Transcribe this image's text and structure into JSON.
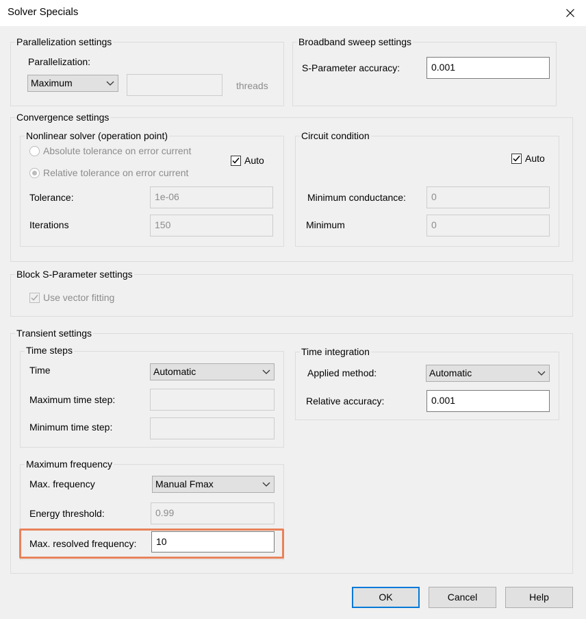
{
  "window": {
    "title": "Solver Specials"
  },
  "parallelization": {
    "group_title": "Parallelization settings",
    "label": "Parallelization:",
    "selected": "Maximum",
    "threads_value": "",
    "threads_label": "threads"
  },
  "broadband": {
    "group_title": "Broadband sweep settings",
    "accuracy_label": "S-Parameter accuracy:",
    "accuracy_value": "0.001"
  },
  "convergence": {
    "group_title": "Convergence settings",
    "nonlinear": {
      "group_title": "Nonlinear solver (operation point)",
      "radio_absolute": "Absolute tolerance on error current",
      "radio_relative": "Relative tolerance on error current",
      "auto_label": "Auto",
      "tolerance_label": "Tolerance:",
      "tolerance_value": "1e-06",
      "iterations_label": "Iterations",
      "iterations_value": "150"
    },
    "circuit": {
      "group_title": "Circuit condition",
      "auto_label": "Auto",
      "min_conductance_label": "Minimum conductance:",
      "min_conductance_value": "0",
      "minimum_label": "Minimum",
      "minimum_value": "0"
    }
  },
  "block_sparam": {
    "group_title": "Block S-Parameter settings",
    "vector_fitting_label": "Use vector fitting"
  },
  "transient": {
    "group_title": "Transient settings",
    "time_steps": {
      "group_title": "Time steps",
      "time_label": "Time",
      "time_selected": "Automatic",
      "max_step_label": "Maximum time step:",
      "max_step_value": "",
      "min_step_label": "Minimum time step:",
      "min_step_value": ""
    },
    "time_integration": {
      "group_title": "Time integration",
      "method_label": "Applied method:",
      "method_selected": "Automatic",
      "rel_accuracy_label": "Relative accuracy:",
      "rel_accuracy_value": "0.001"
    },
    "max_freq": {
      "group_title": "Maximum frequency",
      "max_freq_label": "Max. frequency",
      "max_freq_selected": "Manual Fmax",
      "energy_label": "Energy threshold:",
      "energy_value": "0.99",
      "resolved_label": "Max. resolved frequency:",
      "resolved_value": "10"
    }
  },
  "buttons": {
    "ok": "OK",
    "cancel": "Cancel",
    "help": "Help"
  },
  "colors": {
    "highlight": "#e8825a",
    "default_button_border": "#0078d7"
  }
}
